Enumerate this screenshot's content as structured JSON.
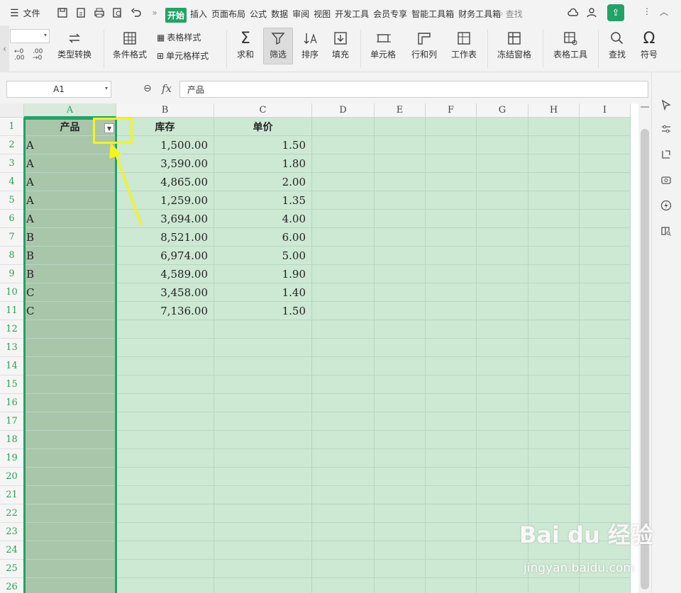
{
  "menubar": {
    "menu_label": "文件",
    "tabs": [
      "开始",
      "插入",
      "页面布局",
      "公式",
      "数据",
      "审阅",
      "视图",
      "开发工具",
      "会员专享",
      "智能工具箱",
      "财务工具箱"
    ],
    "search_label": "查找",
    "more_glyph": "»"
  },
  "ribbon": {
    "type_convert": "类型转换",
    "cond_format": "条件格式",
    "table_style": "表格样式",
    "cell_style": "单元格样式",
    "sum": "求和",
    "filter": "筛选",
    "sort": "排序",
    "fill": "填充",
    "cell": "单元格",
    "row_col": "行和列",
    "worksheet": "工作表",
    "freeze": "冻结窗格",
    "table_tools": "表格工具",
    "find": "查找",
    "symbol": "符号",
    "dec_inc": ".00",
    "dec_dec": ".00"
  },
  "formula_bar": {
    "name_box": "A1",
    "fx": "fx",
    "content": "产品"
  },
  "columns": [
    "A",
    "B",
    "C",
    "D",
    "E",
    "F",
    "G",
    "H",
    "I"
  ],
  "rows": [
    "1",
    "2",
    "3",
    "4",
    "5",
    "6",
    "7",
    "8",
    "9",
    "10",
    "11",
    "12",
    "13",
    "14",
    "15",
    "16",
    "17",
    "18",
    "19",
    "20",
    "21",
    "22",
    "23",
    "24",
    "25",
    "26"
  ],
  "table": {
    "headers": [
      "产品",
      "库存",
      "单价"
    ],
    "data": [
      [
        "A",
        "1,500.00",
        "1.50"
      ],
      [
        "A",
        "3,590.00",
        "1.80"
      ],
      [
        "A",
        "4,865.00",
        "2.00"
      ],
      [
        "A",
        "1,259.00",
        "1.35"
      ],
      [
        "A",
        "3,694.00",
        "4.00"
      ],
      [
        "B",
        "8,521.00",
        "6.00"
      ],
      [
        "B",
        "6,974.00",
        "5.00"
      ],
      [
        "B",
        "4,589.00",
        "1.90"
      ],
      [
        "C",
        "3,458.00",
        "1.40"
      ],
      [
        "C",
        "7,136.00",
        "1.50"
      ]
    ]
  },
  "watermark": {
    "brand": "Bai du 经验",
    "url": "jingyan.baidu.com"
  },
  "colors": {
    "accent": "#21a366",
    "selected_col": "#a9c6aa",
    "cell_bg": "#cde8d3",
    "highlight": "#f5f51a"
  }
}
